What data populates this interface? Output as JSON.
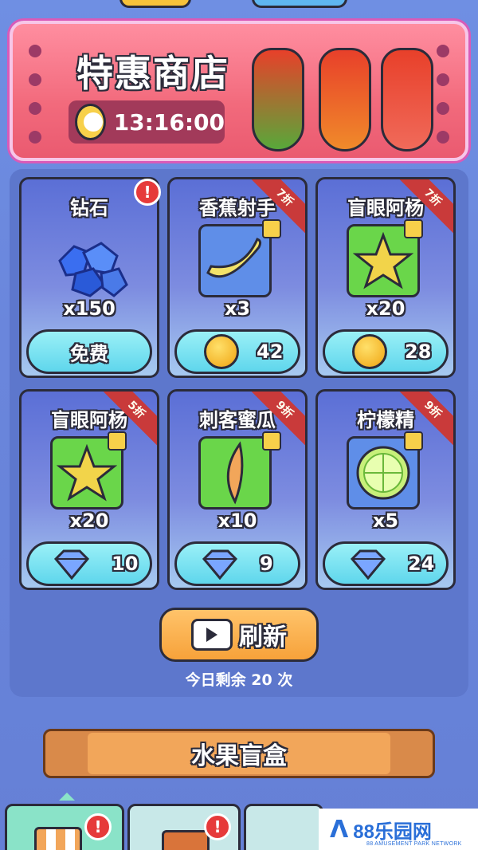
{
  "shop": {
    "title": "特惠商店",
    "timer": "13:16:00"
  },
  "cards": [
    {
      "name": "钻石",
      "qty": "x150",
      "price_type": "free",
      "price": "免费",
      "ribbon": "",
      "alert": "!",
      "icon": "diamond-pile-icon",
      "tile_color": ""
    },
    {
      "name": "香蕉射手",
      "qty": "x3",
      "price_type": "coin",
      "price": "42",
      "ribbon": "7折",
      "alert": "",
      "icon": "banana-icon",
      "tile_color": "#5f8ee8"
    },
    {
      "name": "盲眼阿杨",
      "qty": "x20",
      "price_type": "coin",
      "price": "28",
      "ribbon": "7折",
      "alert": "",
      "icon": "star-fruit-icon",
      "tile_color": "#6ad64a"
    },
    {
      "name": "盲眼阿杨",
      "qty": "x20",
      "price_type": "gem",
      "price": "10",
      "ribbon": "5折",
      "alert": "",
      "icon": "star-fruit-icon",
      "tile_color": "#6ad64a"
    },
    {
      "name": "刺客蜜瓜",
      "qty": "x10",
      "price_type": "gem",
      "price": "9",
      "ribbon": "9折",
      "alert": "",
      "icon": "melon-slice-icon",
      "tile_color": "#6ad64a"
    },
    {
      "name": "柠檬精",
      "qty": "x5",
      "price_type": "gem",
      "price": "24",
      "ribbon": "9折",
      "alert": "",
      "icon": "lime-slice-icon",
      "tile_color": "#5f8ee8"
    }
  ],
  "refresh": {
    "label": "刷新",
    "remaining": "今日剩余 20 次"
  },
  "fruit_box": {
    "label": "水果盲盒"
  },
  "tabs": [
    {
      "alert": "!"
    },
    {
      "alert": "!"
    }
  ],
  "watermark": {
    "name": "88乐园网",
    "sub": "88 AMUSEMENT PARK NETWORK"
  },
  "colors": {
    "background": "#6a86dc",
    "banner": "#f26a7c",
    "price_button": "#5fd6ec",
    "refresh_button": "#f7a23a",
    "ribbon": "#c93a3a"
  }
}
